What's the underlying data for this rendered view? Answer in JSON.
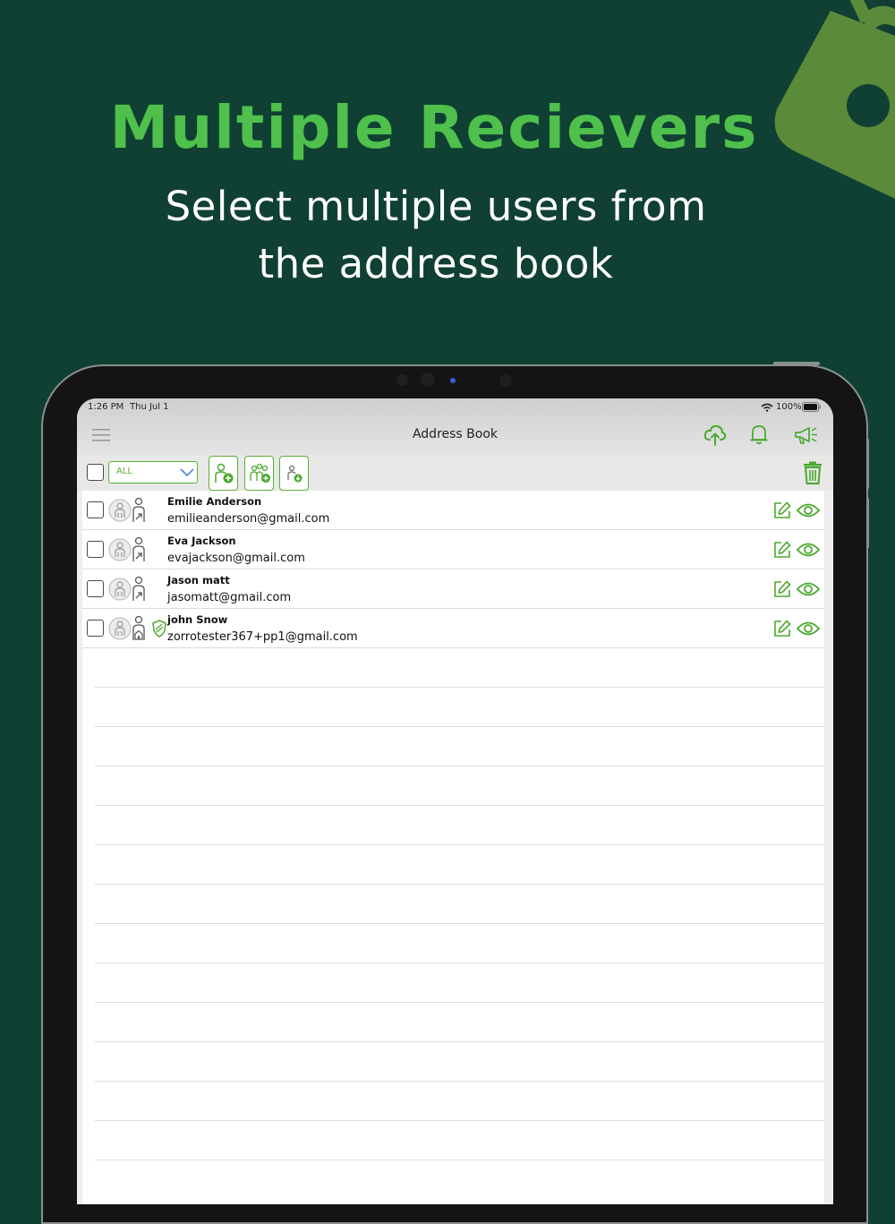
{
  "promo": {
    "title": "Multiple Recievers",
    "subtitle_line1": "Select multiple users from",
    "subtitle_line2": "the address book"
  },
  "status_bar": {
    "time": "1:26 PM",
    "date": "Thu Jul 1",
    "battery": "100%"
  },
  "nav": {
    "title": "Address Book",
    "icons": [
      "menu-icon",
      "cloud-upload-icon",
      "bell-icon",
      "megaphone-icon"
    ]
  },
  "toolbar": {
    "filter_value": "ALL",
    "buttons": [
      "add-user-icon",
      "add-group-icon",
      "import-contact-icon",
      "trash-icon"
    ]
  },
  "contacts": [
    {
      "name": "Emilie Anderson",
      "email": "emilieanderson@gmail.com",
      "verified": false
    },
    {
      "name": "Eva Jackson",
      "email": "evajackson@gmail.com",
      "verified": false
    },
    {
      "name": "Jason matt",
      "email": "jasomatt@gmail.com",
      "verified": false
    },
    {
      "name": "john  Snow",
      "email": "zorrotester367+pp1@gmail.com",
      "verified": true
    }
  ],
  "colors": {
    "background": "#0f4033",
    "accent_green": "#4fc04b",
    "icon_green": "#5aae36",
    "lock_olive": "#5b8a3a"
  }
}
